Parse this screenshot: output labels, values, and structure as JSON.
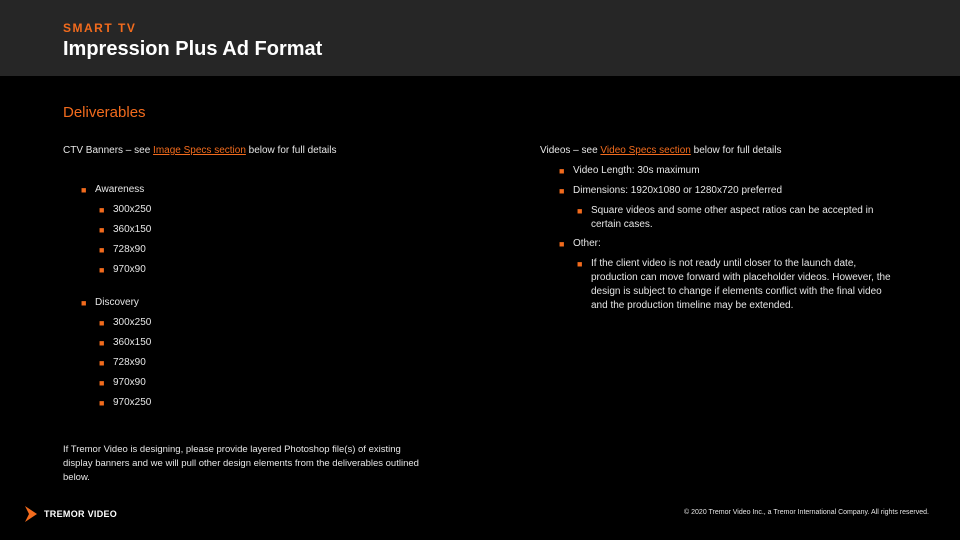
{
  "header": {
    "eyebrow": "SMART TV",
    "title": "Impression Plus Ad Format"
  },
  "section_title": "Deliverables",
  "left_column": {
    "intro_prefix": "CTV Banners – see ",
    "intro_link": "Image Specs section",
    "intro_suffix": " below for full details",
    "groups": [
      {
        "label": "Awareness",
        "sizes": [
          "300x250",
          "360x150",
          "728x90",
          "970x90"
        ]
      },
      {
        "label": "Discovery",
        "sizes": [
          "300x250",
          "360x150",
          "728x90",
          "970x90",
          "970x250"
        ]
      }
    ]
  },
  "right_column": {
    "intro_prefix": "Videos – see ",
    "intro_link": "Video Specs section",
    "intro_suffix": " below for full details",
    "video_length": "Video Length: 30s maximum",
    "dimensions": "Dimensions: 1920x1080 or 1280x720 preferred",
    "dimensions_note": "Square videos and some other aspect ratios can be accepted in certain cases.",
    "other_label": "Other:",
    "other_note": "If the client video is not ready until closer to the launch date, production can move forward with placeholder videos. However, the design is subject to change if elements conflict with the final video and the production timeline may be extended."
  },
  "note": "If Tremor Video is designing, please provide layered Photoshop file(s) of existing display banners and we will pull other design elements from the deliverables outlined below.",
  "footer": {
    "logo_text": "TREMOR VIDEO",
    "logo_icon": "tremor-logo-icon",
    "copyright": "© 2020 Tremor Video Inc., a Tremor International Company. All rights reserved."
  },
  "colors": {
    "accent": "#f26b1d",
    "header_bg": "#262626",
    "background": "#000000"
  }
}
